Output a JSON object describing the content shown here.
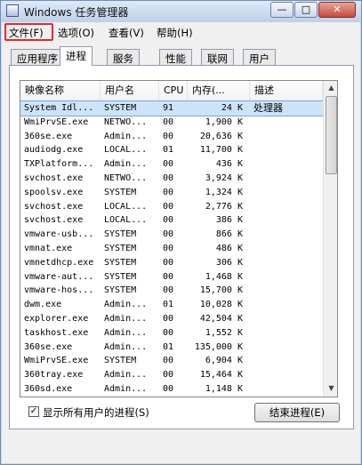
{
  "window": {
    "title": "Windows 任务管理器",
    "controls": {
      "minimize": "—",
      "maximize": "□",
      "close": "✕"
    }
  },
  "menubar": {
    "items": [
      "文件(F)",
      "选项(O)",
      "查看(V)",
      "帮助(H)"
    ],
    "highlighted": "文件(F)",
    "highlight_color": "#e8282f"
  },
  "tabs": [
    {
      "label": "应用程序",
      "active": false
    },
    {
      "label": "进程",
      "active": true
    },
    {
      "label": "服务",
      "active": false
    },
    {
      "label": "性能",
      "active": false
    },
    {
      "label": "联网",
      "active": false
    },
    {
      "label": "用户",
      "active": false
    }
  ],
  "process_table": {
    "columns": [
      "映像名称",
      "用户名",
      "CPU",
      "内存(...",
      "描述"
    ],
    "rows": [
      [
        "System Idl...",
        "SYSTEM",
        "91",
        "24 K",
        "处理器"
      ],
      [
        "WmiPrvSE.exe",
        "NETWO...",
        "00",
        "1,900 K",
        ""
      ],
      [
        "360se.exe",
        "Admin...",
        "00",
        "20,636 K",
        ""
      ],
      [
        "audiodg.exe",
        "LOCAL...",
        "01",
        "11,700 K",
        ""
      ],
      [
        "TXPlatform...",
        "Admin...",
        "00",
        "436 K",
        ""
      ],
      [
        "svchost.exe",
        "NETWO...",
        "00",
        "3,924 K",
        ""
      ],
      [
        "spoolsv.exe",
        "SYSTEM",
        "00",
        "1,324 K",
        ""
      ],
      [
        "svchost.exe",
        "LOCAL...",
        "00",
        "2,776 K",
        ""
      ],
      [
        "svchost.exe",
        "LOCAL...",
        "00",
        "386 K",
        ""
      ],
      [
        "vmware-usb...",
        "SYSTEM",
        "00",
        "866 K",
        ""
      ],
      [
        "vmnat.exe",
        "SYSTEM",
        "00",
        "486 K",
        ""
      ],
      [
        "vmnetdhcp.exe",
        "SYSTEM",
        "00",
        "306 K",
        ""
      ],
      [
        "vmware-aut...",
        "SYSTEM",
        "00",
        "1,468 K",
        ""
      ],
      [
        "vmware-hos...",
        "SYSTEM",
        "00",
        "15,700 K",
        ""
      ],
      [
        "dwm.exe",
        "Admin...",
        "01",
        "10,028 K",
        ""
      ],
      [
        "explorer.exe",
        "Admin...",
        "00",
        "42,504 K",
        ""
      ],
      [
        "taskhost.exe",
        "Admin...",
        "00",
        "1,552 K",
        ""
      ],
      [
        "360se.exe",
        "Admin...",
        "01",
        "135,000 K",
        ""
      ],
      [
        "WmiPrvSE.exe",
        "SYSTEM",
        "00",
        "6,904 K",
        ""
      ],
      [
        "360tray.exe",
        "Admin...",
        "00",
        "15,464 K",
        ""
      ],
      [
        "360sd.exe",
        "Admin...",
        "00",
        "1,148 K",
        ""
      ]
    ],
    "selected_row": "System Idl..."
  },
  "scrollbar": {
    "up_icon": "▲",
    "down_icon": "▼"
  },
  "footer": {
    "show_all_users_label": "显示所有用户的进程(S)",
    "show_all_users_checked": true,
    "check_mark": "✓",
    "end_process_label": "结束进程(E)"
  }
}
